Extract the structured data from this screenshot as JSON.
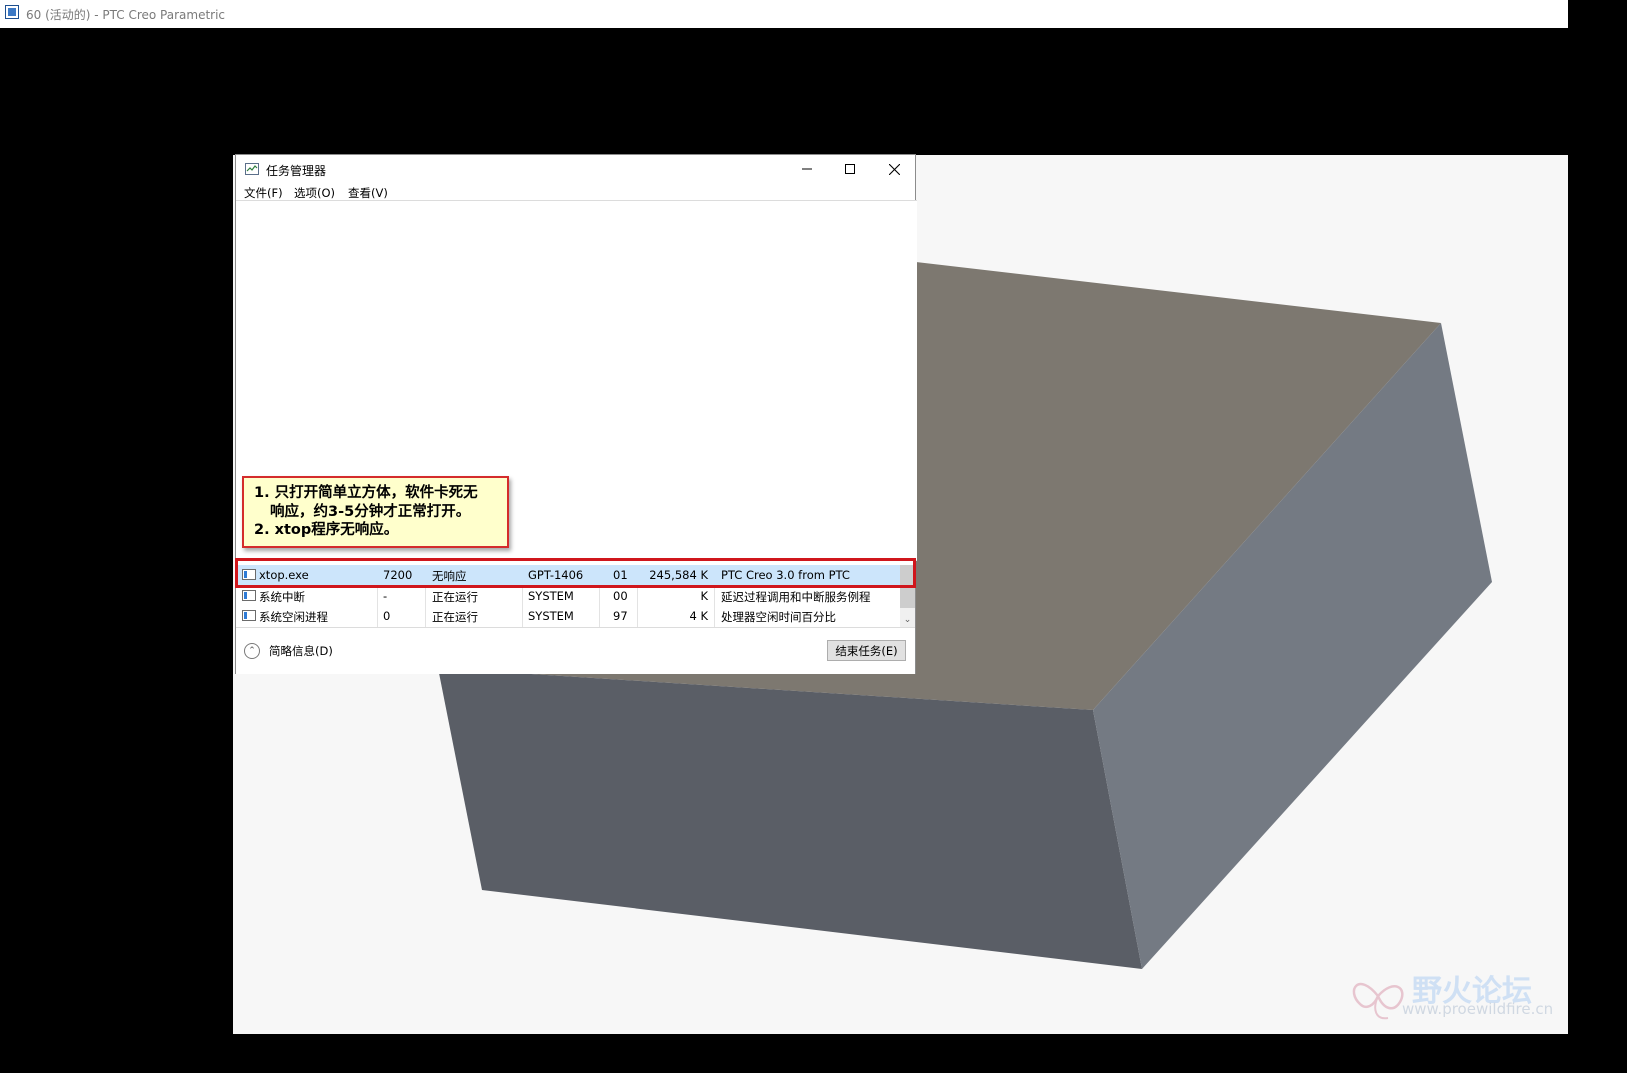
{
  "window": {
    "title": "60 (活动的) - PTC Creo Parametric",
    "icon": "creo-window-icon"
  },
  "task_manager": {
    "title": "任务管理器",
    "icon": "task-manager-icon",
    "controls": {
      "minimize": "—",
      "maximize": "☐",
      "close": "✕"
    },
    "menu": [
      "文件(F)",
      "选项(O)",
      "查看(V)"
    ],
    "processes": [
      {
        "name": "xtop.exe",
        "pid": "7200",
        "status": "无响应",
        "user": "GPT-1406",
        "cpu": "01",
        "memory": "245,584 K",
        "description": "PTC Creo 3.0 from PTC",
        "selected": true
      },
      {
        "name": "系统中断",
        "pid": "-",
        "status": "正在运行",
        "user": "SYSTEM",
        "cpu": "00",
        "memory": "K",
        "description": "延迟过程调用和中断服务例程",
        "selected": false
      },
      {
        "name": "系统空闲进程",
        "pid": "0",
        "status": "正在运行",
        "user": "SYSTEM",
        "cpu": "97",
        "memory": "4 K",
        "description": "处理器空闲时间百分比",
        "selected": false
      }
    ],
    "brief_info_label": "简略信息(D)",
    "end_task_label": "结束任务(E)"
  },
  "callout": {
    "line1": "1. 只打开简单立方体，软件卡死无",
    "line2": "响应，约3-5分钟才正常打开。",
    "line3": "2. xtop程序无响应。"
  },
  "watermark": {
    "name": "野火论坛",
    "url": "www.proewildfire.cn"
  },
  "colors": {
    "viewport_bg": "#f7f7f7",
    "box_top": "#7d7870",
    "box_front": "#5a5e66",
    "box_right": "#747a83",
    "callout_bg": "#ffffcc",
    "highlight": "#d0161c",
    "selected_row": "#cce5fb"
  }
}
